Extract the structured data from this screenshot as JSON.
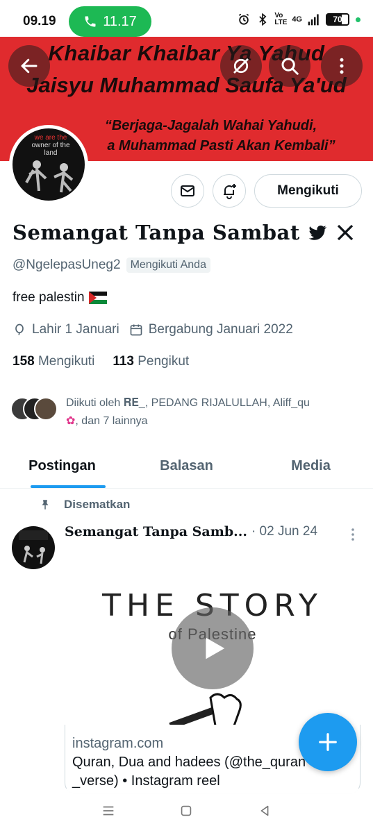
{
  "status_bar": {
    "time": "09.19",
    "call_timer": "11.17",
    "battery": "70",
    "network": "4G",
    "volte": "Vo LTE"
  },
  "banner": {
    "line1": "Khaibar Khaibar Ya Yahud",
    "line2": "Jaisyu Muhammad Saufa Ya'ud",
    "line3": "“Berjaga-Jagalah Wahai Yahudi,",
    "line4": "a Muhammad Pasti Akan Kembali”"
  },
  "avatar": {
    "line1": "we are the",
    "line2": "owner of the",
    "line3": "land"
  },
  "actions": {
    "follow_label": "Mengikuti"
  },
  "profile": {
    "display_name": "Semangat Tanpa Sambat",
    "handle": "@NgelepasUneg2",
    "follows_you": "Mengikuti Anda",
    "bio": "free palestin",
    "birthday": "Lahir 1 Januari",
    "joined": "Bergabung Januari 2022",
    "following_count": "158",
    "following_label": "Mengikuti",
    "followers_count": "113",
    "followers_label": "Pengikut",
    "followed_by_text": "Diikuti oleh 𝐑𝐄_, PEDANG RIJALULLAH, Aliff_qu",
    "followed_by_text2": ", dan 7 lainnya"
  },
  "tabs": [
    {
      "label": "Postingan"
    },
    {
      "label": "Balasan"
    },
    {
      "label": "Media"
    }
  ],
  "pinned_post": {
    "pinned_label": "Disematkan",
    "author": "Semangat Tanpa Samb...",
    "date": "· 02 Jun 24",
    "media_title": "THE STORY",
    "media_sub": "of Palestine",
    "link_domain": "instagram.com",
    "link_title": "Quran, Dua and hadees (@the_quran",
    "link_sub": "_verse) • Instagram reel"
  },
  "colors": {
    "accent": "#1d9bf0",
    "banner": "#e02b2e",
    "call_pill": "#1db954",
    "secondary_text": "#536471"
  }
}
